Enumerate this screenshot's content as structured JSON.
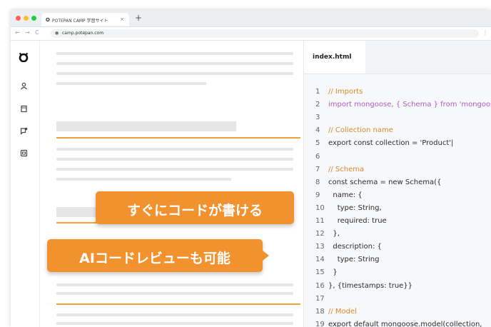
{
  "browser": {
    "tab_title": "POTEPAN CAMP 学習サイト",
    "tab_close": "×",
    "new_tab": "+",
    "nav_back": "←",
    "nav_forward": "→",
    "nav_reload": "C",
    "lock": "●",
    "url": "camp.potepan.com",
    "menu": "⋮",
    "traffic_colors": [
      "#ff5f57",
      "#febc2e",
      "#28c840"
    ]
  },
  "sidebar": {
    "icons": [
      "logo-icon",
      "user-icon",
      "book-icon",
      "chat-icon",
      "quiz-icon"
    ]
  },
  "code_panel": {
    "tab_label": "index.html",
    "lines": [
      {
        "n": "1",
        "text": "// Imports",
        "type": "comment"
      },
      {
        "n": "2",
        "text": "import mongoose, { Schema } from 'mongoose'",
        "type": "purple"
      },
      {
        "n": "3",
        "text": "",
        "type": "plain"
      },
      {
        "n": "4",
        "text": "// Collection name",
        "type": "comment"
      },
      {
        "n": "5",
        "text": "export const collection = 'Product'|",
        "type": "plain"
      },
      {
        "n": "6",
        "text": "",
        "type": "plain"
      },
      {
        "n": "7",
        "text": "// Schema",
        "type": "comment"
      },
      {
        "n": "8",
        "text": "const schema = new Schema({",
        "type": "plain"
      },
      {
        "n": "9",
        "text": "  name: {",
        "type": "plain"
      },
      {
        "n": "10",
        "text": "    type: String,",
        "type": "plain"
      },
      {
        "n": "11",
        "text": "    required: true",
        "type": "plain"
      },
      {
        "n": "12",
        "text": "  },",
        "type": "plain"
      },
      {
        "n": "13",
        "text": "  description: {",
        "type": "plain"
      },
      {
        "n": "14",
        "text": "    type: String",
        "type": "plain"
      },
      {
        "n": "15",
        "text": "  }",
        "type": "plain"
      },
      {
        "n": "16",
        "text": "}, {timestamps: true}}",
        "type": "plain"
      },
      {
        "n": "17",
        "text": "",
        "type": "plain"
      },
      {
        "n": "18",
        "text": "// Model",
        "type": "comment"
      },
      {
        "n": "19",
        "text": "export default mongoose.model(collection,",
        "type": "plain"
      }
    ]
  },
  "callouts": {
    "first": "すぐにコードが書ける",
    "second": "AIコードレビューも可能"
  },
  "colors": {
    "accent_orange": "#f2922e",
    "comment": "#d9892b",
    "keyword_purple": "#b05ac8"
  }
}
